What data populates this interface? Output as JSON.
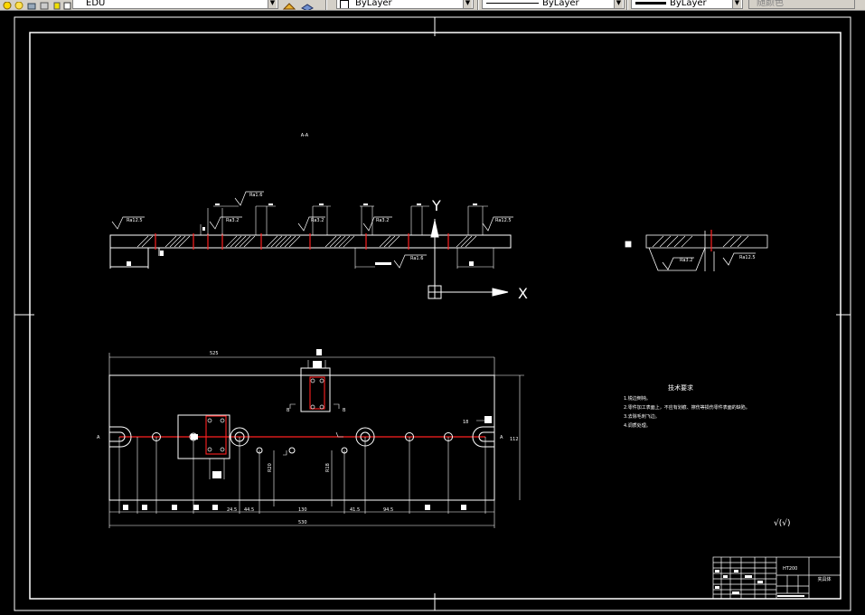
{
  "toolbar": {
    "layer_combo_value": "EDU",
    "color_combo_value": "ByLayer",
    "linetype_combo_value": "ByLayer",
    "lineweight_combo_value": "ByLayer",
    "plotstyle_combo_value": "随颜色"
  },
  "drawing": {
    "section_label": "A-A",
    "tech_title": "技术要求",
    "tech_items": [
      "1.锐边倒钝。",
      "2.零件加工表面上，不应有划痕、擦伤等损伤零件表面的缺陷。",
      "3.去除毛刺飞边。",
      "4.调质处理。"
    ],
    "rough_left_1": "Ra12.5",
    "rough_left_2": "Ra1.6",
    "rough_left_3": "Ra3.2",
    "rough_mid_1": "Ra3.2",
    "rough_mid_2": "Ra3.2",
    "rough_mid_3": "Ra1.6",
    "rough_right_1": "Ra12.5",
    "rough_side_1": "Ra3.2",
    "rough_side_2": "Ra12.5",
    "overall_length": "525",
    "bottom_length": "530",
    "dim_height": "112",
    "dim_130": "130",
    "dim_a": "41.5",
    "dim_b": "94.5",
    "dim_c": "24.5",
    "dim_d": "44.5",
    "dim_e": "R20",
    "dim_f": "R18",
    "dim_g": "18",
    "section_mark_a": "A",
    "section_mark_b": "B",
    "overall_rough": "√(√)",
    "title_block_name": "夹具体",
    "title_block_material": "HT200",
    "ucs_x": "X",
    "ucs_y": "Y"
  }
}
